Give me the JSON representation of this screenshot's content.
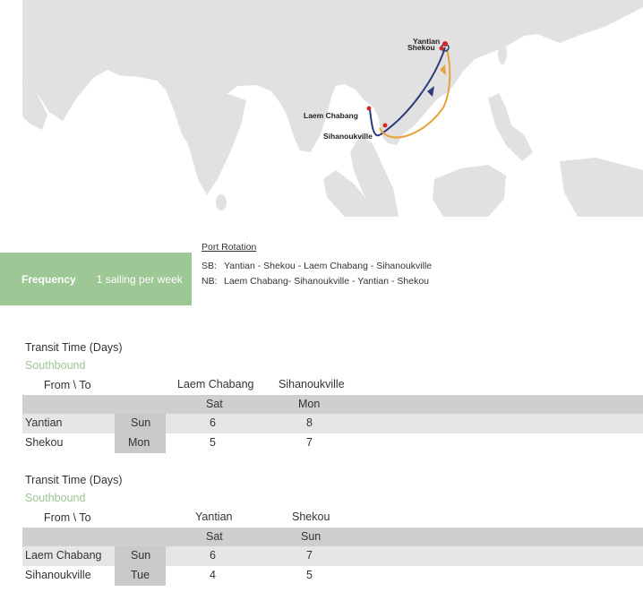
{
  "map": {
    "ports": [
      "Yantian",
      "Shekou",
      "Laem Chabang",
      "Sihanoukville"
    ],
    "route_colors": {
      "southbound": "#2b3a7a",
      "northbound": "#e8a23a",
      "port": "#d62828",
      "land": "#e1e1e1",
      "sea": "#ffffff"
    }
  },
  "frequency": {
    "label": "Frequency",
    "value": "1 sailing per week"
  },
  "rotation": {
    "title": "Port Rotation",
    "sb_label": "SB:",
    "sb_value": "Yantian - Shekou - Laem Chabang - Sihanoukville",
    "nb_label": "NB:",
    "nb_value": "Laem Chabang- Sihanoukville - Yantian - Shekou"
  },
  "tables": [
    {
      "title": "Transit Time (Days)",
      "direction": "Southbound",
      "from_to": "From \\ To",
      "destinations": [
        "Laem Chabang",
        "Sihanoukville"
      ],
      "dest_days": [
        "Sat",
        "Mon"
      ],
      "rows": [
        {
          "port": "Yantian",
          "day": "Sun",
          "values": [
            "6",
            "8"
          ]
        },
        {
          "port": "Shekou",
          "day": "Mon",
          "values": [
            "5",
            "7"
          ]
        }
      ]
    },
    {
      "title": "Transit Time (Days)",
      "direction": "Southbound",
      "from_to": "From \\ To",
      "destinations": [
        "Yantian",
        "Shekou"
      ],
      "dest_days": [
        "Sat",
        "Sun"
      ],
      "rows": [
        {
          "port": "Laem Chabang",
          "day": "Sun",
          "values": [
            "6",
            "7"
          ]
        },
        {
          "port": "Sihanoukville",
          "day": "Tue",
          "values": [
            "4",
            "5"
          ]
        }
      ]
    }
  ]
}
